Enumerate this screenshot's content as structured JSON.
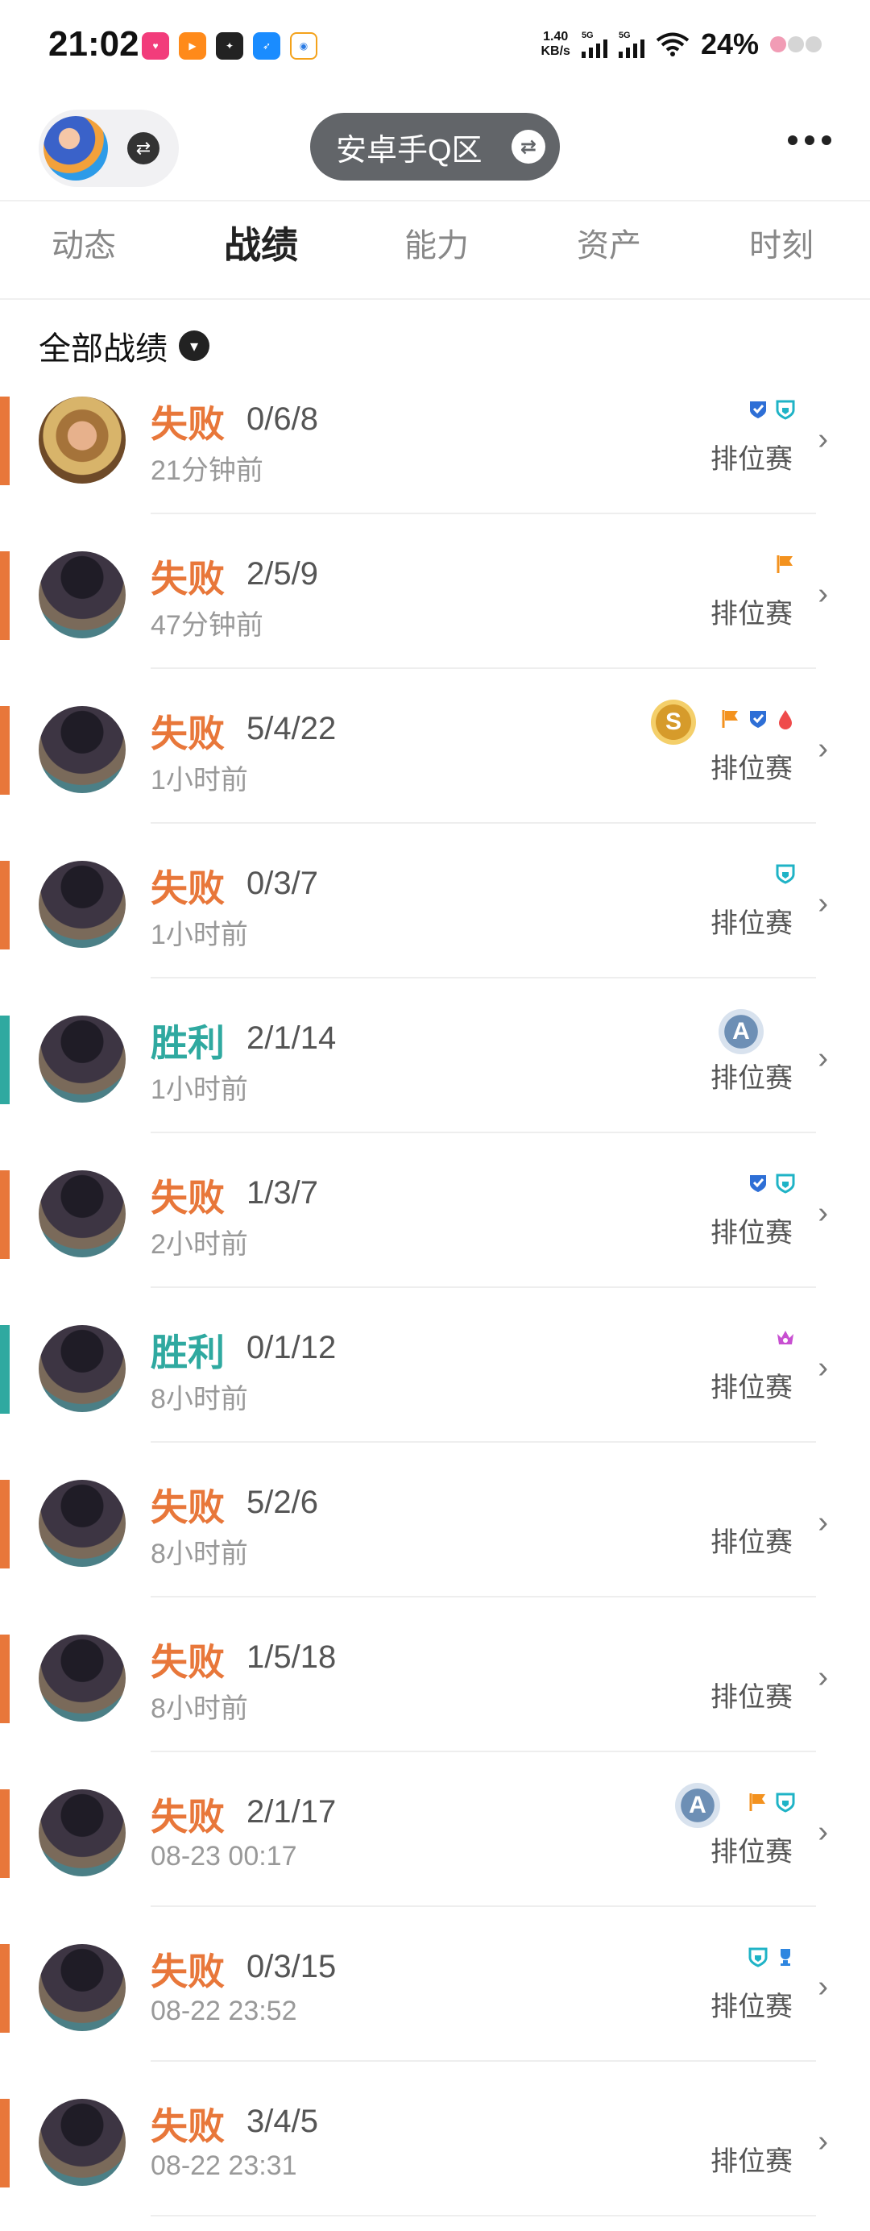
{
  "status_bar": {
    "time": "21:02",
    "speed_value": "1.40",
    "speed_unit": "KB/s",
    "net_label_1": "5G",
    "net_label_2": "5G",
    "battery": "24%"
  },
  "header": {
    "server_label": "安卓手Q区"
  },
  "tabs": [
    {
      "label": "动态"
    },
    {
      "label": "战绩",
      "active": true
    },
    {
      "label": "能力"
    },
    {
      "label": "资产"
    },
    {
      "label": "时刻"
    }
  ],
  "filter": {
    "label": "全部战绩"
  },
  "colors": {
    "loss": "#e8773a",
    "win": "#2fa9a0"
  },
  "matches": [
    {
      "result": "失败",
      "kda": "0/6/8",
      "time": "21分钟前",
      "mode": "排位赛",
      "avatar": "blondie",
      "tags": [
        "mvp-shield-icon",
        "defense-shield-icon"
      ],
      "badge": null
    },
    {
      "result": "失败",
      "kda": "2/5/9",
      "time": "47分钟前",
      "mode": "排位赛",
      "avatar": "ugly",
      "tags": [
        "flag-icon"
      ],
      "badge": null
    },
    {
      "result": "失败",
      "kda": "5/4/22",
      "time": "1小时前",
      "mode": "排位赛",
      "avatar": "ugly",
      "tags": [
        "flag-icon",
        "mvp-shield-icon",
        "blood-drop-icon"
      ],
      "badge": "S"
    },
    {
      "result": "失败",
      "kda": "0/3/7",
      "time": "1小时前",
      "mode": "排位赛",
      "avatar": "ugly",
      "tags": [
        "defense-shield-icon"
      ],
      "badge": null
    },
    {
      "result": "胜利",
      "kda": "2/1/14",
      "time": "1小时前",
      "mode": "排位赛",
      "avatar": "ugly",
      "tags": [],
      "badge": "A"
    },
    {
      "result": "失败",
      "kda": "1/3/7",
      "time": "2小时前",
      "mode": "排位赛",
      "avatar": "ugly",
      "tags": [
        "mvp-shield-icon",
        "defense-shield-icon"
      ],
      "badge": null
    },
    {
      "result": "胜利",
      "kda": "0/1/12",
      "time": "8小时前",
      "mode": "排位赛",
      "avatar": "ugly",
      "tags": [
        "crown-icon"
      ],
      "badge": null
    },
    {
      "result": "失败",
      "kda": "5/2/6",
      "time": "8小时前",
      "mode": "排位赛",
      "avatar": "ugly",
      "tags": [],
      "badge": null
    },
    {
      "result": "失败",
      "kda": "1/5/18",
      "time": "8小时前",
      "mode": "排位赛",
      "avatar": "ugly",
      "tags": [],
      "badge": null
    },
    {
      "result": "失败",
      "kda": "2/1/17",
      "time": "08-23 00:17",
      "mode": "排位赛",
      "avatar": "ugly",
      "tags": [
        "flag-icon",
        "defense-shield-icon"
      ],
      "badge": "A"
    },
    {
      "result": "失败",
      "kda": "0/3/15",
      "time": "08-22 23:52",
      "mode": "排位赛",
      "avatar": "ugly",
      "tags": [
        "defense-shield-icon",
        "trophy-icon"
      ],
      "badge": null
    },
    {
      "result": "失败",
      "kda": "3/4/5",
      "time": "08-22 23:31",
      "mode": "排位赛",
      "avatar": "ugly",
      "tags": [],
      "badge": null
    }
  ]
}
